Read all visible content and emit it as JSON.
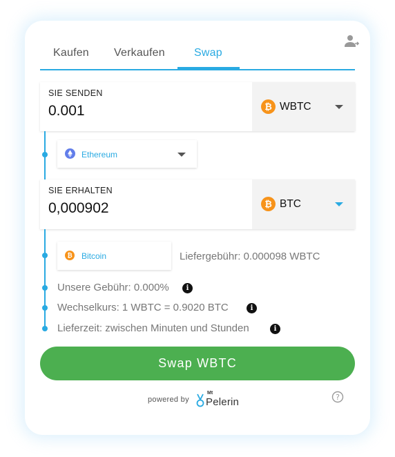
{
  "tabs": [
    "Kaufen",
    "Verkaufen",
    "Swap"
  ],
  "active_tab": "Swap",
  "send": {
    "label": "SIE SENDEN",
    "amount": "0.001",
    "currency": "WBTC",
    "network": "Ethereum"
  },
  "receive": {
    "label": "SIE ERHALTEN",
    "amount": "0,000902",
    "currency": "BTC",
    "network": "Bitcoin"
  },
  "delivery_fee": "Liefergebühr: 0.000098 WBTC",
  "our_fee": "Unsere Gebühr: 0.000%",
  "exchange_rate": "Wechselkurs: 1 WBTC = 0.9020 BTC",
  "delivery_time": "Lieferzeit: zwischen Minuten und Stunden",
  "swap_button": "Swap WBTC",
  "footer": {
    "powered_by": "powered by",
    "brand_small": "Mt",
    "brand_name": "Pelerin"
  },
  "icons": {
    "coin_symbol": "₿",
    "info_symbol": "i",
    "help_symbol": "?"
  },
  "colors": {
    "accent": "#29aae2",
    "swap_button": "#4caf50",
    "bitcoin": "#f7931a",
    "ethereum": "#627eea"
  }
}
